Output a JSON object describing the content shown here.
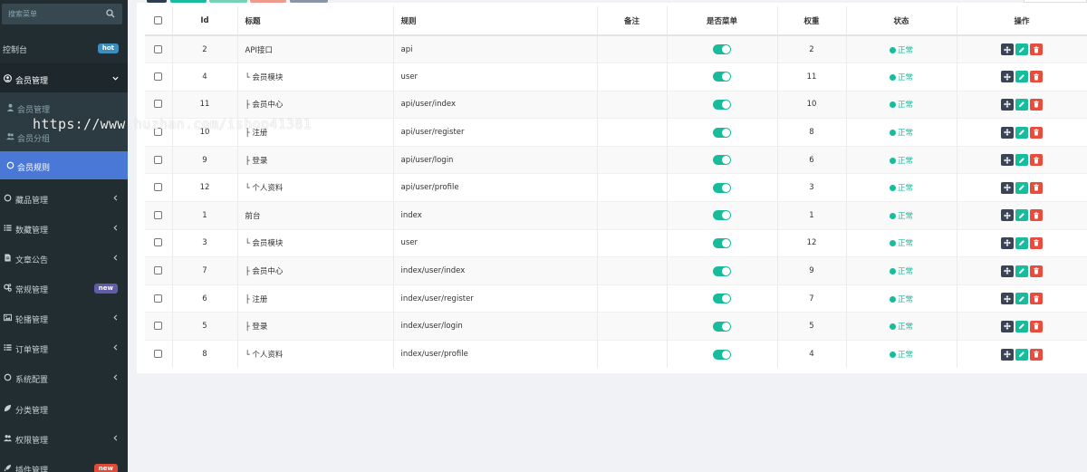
{
  "sidebar": {
    "search_placeholder": "搜索菜单",
    "items": [
      {
        "label": "控制台",
        "badge": "hot",
        "badge_color": "#3c8dbc"
      },
      {
        "label": "会员管理"
      },
      {
        "label": "会员管理"
      },
      {
        "label": "会员分组"
      },
      {
        "label": "会员规则"
      },
      {
        "label": "藏品管理"
      },
      {
        "label": "数藏管理"
      },
      {
        "label": "文章公告"
      },
      {
        "label": "常规管理",
        "badge": "new",
        "badge_color": "#605ca8"
      },
      {
        "label": "轮播管理"
      },
      {
        "label": "订单管理"
      },
      {
        "label": "系统配置"
      },
      {
        "label": "分类管理"
      },
      {
        "label": "权限管理"
      },
      {
        "label": "插件管理",
        "badge": "new",
        "badge_color": "#dd4b39"
      }
    ]
  },
  "table": {
    "headers": {
      "id": "Id",
      "title": "标题",
      "rule": "规则",
      "remark": "备注",
      "ismenu": "是否菜单",
      "weigh": "权重",
      "status": "状态",
      "ops": "操作"
    },
    "rows": [
      {
        "id": "2",
        "title": "API接口",
        "rule": "api",
        "weigh": "2",
        "status": "正常"
      },
      {
        "id": "4",
        "title": "└ 会员模块",
        "rule": "user",
        "weigh": "11",
        "status": "正常"
      },
      {
        "id": "11",
        "title": "├ 会员中心",
        "rule": "api/user/index",
        "weigh": "10",
        "status": "正常"
      },
      {
        "id": "10",
        "title": "├ 注册",
        "rule": "api/user/register",
        "weigh": "8",
        "status": "正常"
      },
      {
        "id": "9",
        "title": "├ 登录",
        "rule": "api/user/login",
        "weigh": "6",
        "status": "正常"
      },
      {
        "id": "12",
        "title": "└ 个人资料",
        "rule": "api/user/profile",
        "weigh": "3",
        "status": "正常"
      },
      {
        "id": "1",
        "title": "前台",
        "rule": "index",
        "weigh": "1",
        "status": "正常"
      },
      {
        "id": "3",
        "title": "└ 会员模块",
        "rule": "user",
        "weigh": "12",
        "status": "正常"
      },
      {
        "id": "7",
        "title": "├ 会员中心",
        "rule": "index/user/index",
        "weigh": "9",
        "status": "正常"
      },
      {
        "id": "6",
        "title": "├ 注册",
        "rule": "index/user/register",
        "weigh": "7",
        "status": "正常"
      },
      {
        "id": "5",
        "title": "├ 登录",
        "rule": "index/user/login",
        "weigh": "5",
        "status": "正常"
      },
      {
        "id": "8",
        "title": "└ 个人资料",
        "rule": "index/user/profile",
        "weigh": "4",
        "status": "正常"
      }
    ]
  },
  "watermark": "https://www.huzhan.com/ishop41381",
  "colors": {
    "sidebar_bg": "#222d32",
    "active": "#4a78d6",
    "success": "#18bc9c",
    "danger": "#e74c3c",
    "dark": "#3a4456"
  }
}
